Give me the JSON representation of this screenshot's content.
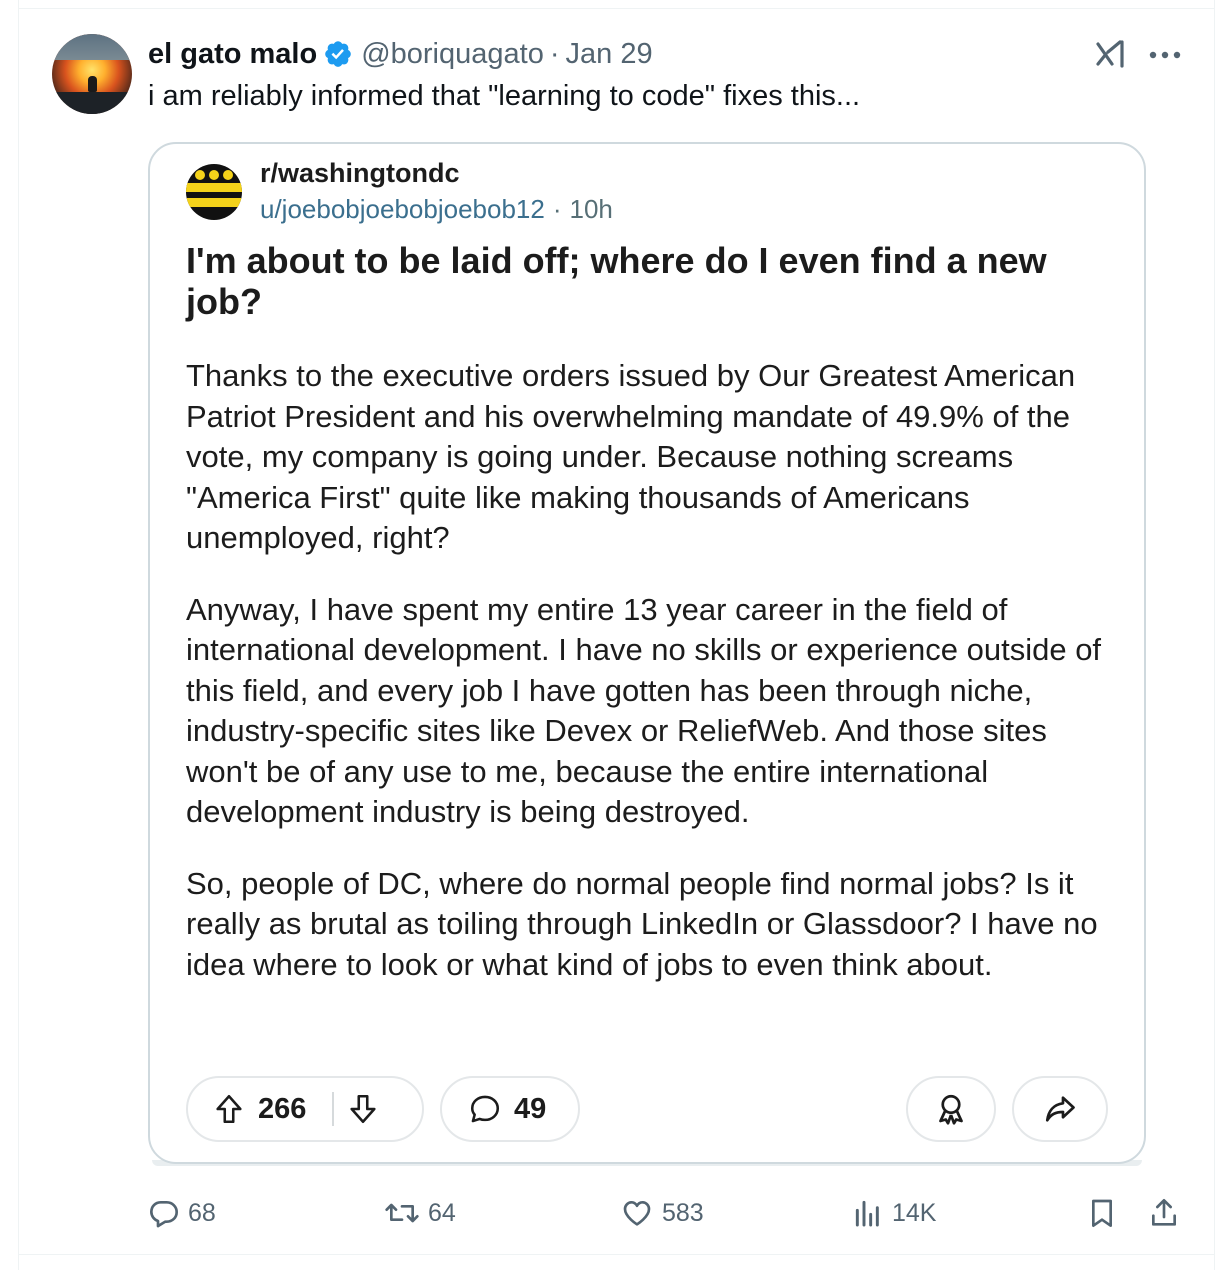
{
  "tweet": {
    "author": {
      "display_name": "el gato malo",
      "handle": "@boriquagato",
      "separator": "·",
      "date": "Jan 29",
      "verified": true
    },
    "text": "i am reliably informed that \"learning to code\" fixes this...",
    "icons": {
      "grok": "grok-icon",
      "more": "more-icon"
    }
  },
  "embed": {
    "subreddit": "r/washingtondc",
    "username": "u/joebobjoebobjoebob12",
    "separator": "·",
    "age": "10h",
    "title": "I'm about to be laid off; where do I even find a new job?",
    "body": [
      "Thanks to the executive orders issued by Our Greatest American Patriot President and his overwhelming mandate of 49.9% of the vote, my company is going under. Because nothing screams \"America First\" quite like making thousands of Americans unemployed, right?",
      "Anyway, I have spent my entire 13 year career in the field of international development. I have no skills or experience outside of this field, and every job I have gotten has been through niche, industry-specific sites like Devex or ReliefWeb. And those sites won't be of any use to me, because the entire international development industry is being destroyed.",
      "So, people of DC, where do normal people find normal jobs? Is it really as brutal as toiling through LinkedIn or Glassdoor? I have no idea where to look or what kind of jobs to even think about."
    ],
    "upvotes": "266",
    "comments": "49"
  },
  "actions": {
    "replies": "68",
    "reposts": "64",
    "likes": "583",
    "views": "14K"
  },
  "colors": {
    "verified": "#1d9bf0",
    "muted": "#536471",
    "reddit_link": "#3b6f8e",
    "subreddit_yellow": "#f4d21a"
  }
}
